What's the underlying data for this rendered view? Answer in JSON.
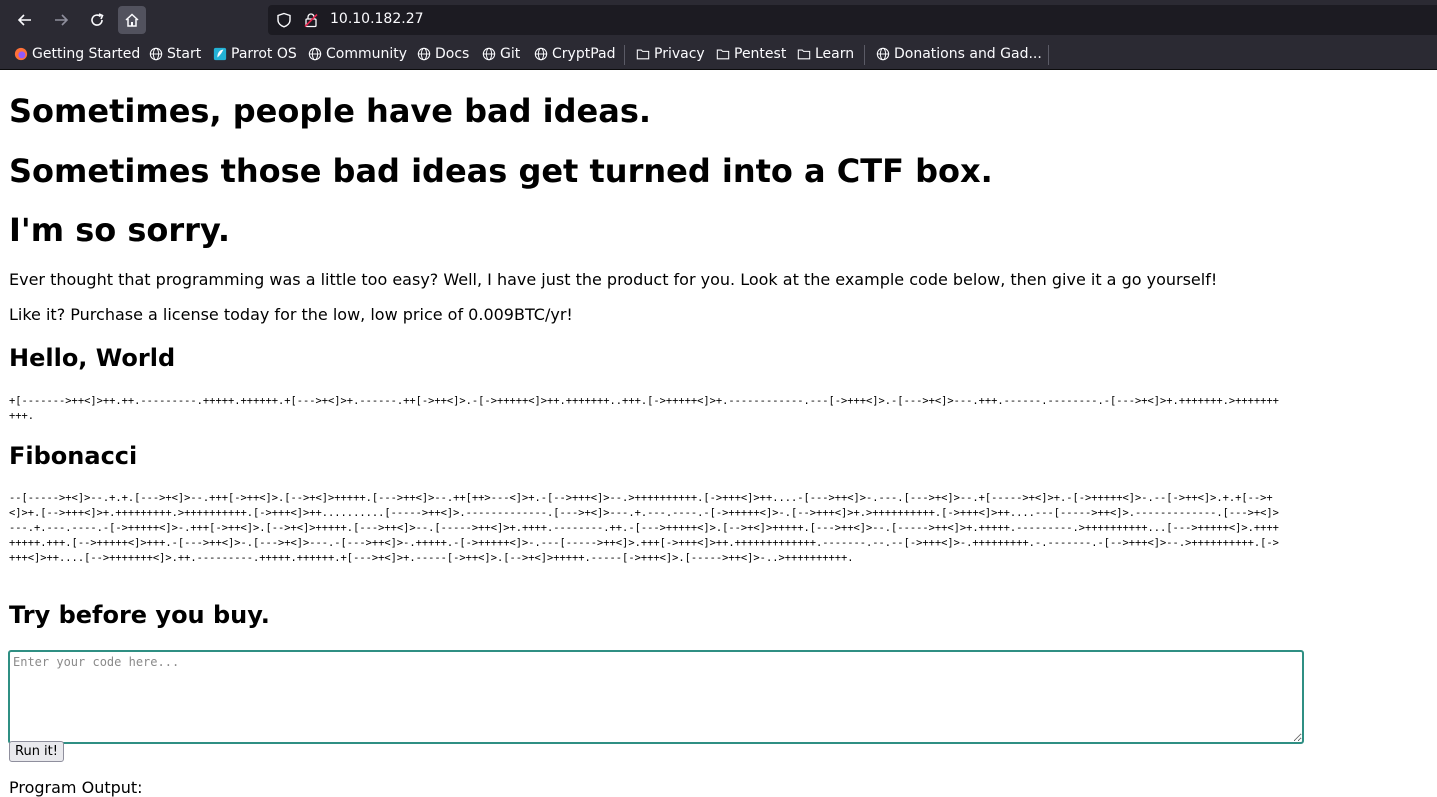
{
  "browser": {
    "url": "10.10.182.27",
    "bookmarks": [
      {
        "label": "Getting Started",
        "icon": "firefox-icon"
      },
      {
        "label": "Start",
        "icon": "globe-icon"
      },
      {
        "label": "Parrot OS",
        "icon": "parrot-icon"
      },
      {
        "label": "Community",
        "icon": "globe-icon"
      },
      {
        "label": "Docs",
        "icon": "globe-icon"
      },
      {
        "label": "Git",
        "icon": "globe-icon"
      },
      {
        "label": "CryptPad",
        "icon": "globe-icon"
      },
      {
        "label": "Privacy",
        "icon": "folder-icon"
      },
      {
        "label": "Pentest",
        "icon": "folder-icon"
      },
      {
        "label": "Learn",
        "icon": "folder-icon"
      },
      {
        "label": "Donations and Gad...",
        "icon": "globe-icon"
      }
    ],
    "colors": {
      "chrome": "#2b2a33",
      "urlbar": "#1c1b22",
      "text": "#fbfbfe",
      "focus": "#2f8f83"
    }
  },
  "page": {
    "heading1": "Sometimes, people have bad ideas.",
    "heading2": "Sometimes those bad ideas get turned into a CTF box.",
    "heading3": "I'm so sorry.",
    "intro": "Ever thought that programming was a little too easy? Well, I have just the product for you. Look at the example code below, then give it a go yourself!",
    "license": "Like it? Purchase a license today for the low, low price of 0.009BTC/yr!",
    "hello_title": "Hello, World",
    "hello_code": "+[------->++<]>++.++.---------.+++++.++++++.+[--->+<]>+.------.++[->++<]>.-[->+++++<]>++.+++++++..+++.[->+++++<]>+.------------.---[->+++<]>.-[--->+<]>---.+++.------.--------.-[--->+<]>+.+++++++.>++++++++++.",
    "fib_title": "Fibonacci",
    "fib_code": "--[----->+<]>--.+.+.[--->+<]>--.+++[->++<]>.[-->+<]>+++++.[--->++<]>--.++[++>---<]>+.-[-->+++<]>--.>++++++++++.[->+++<]>++....-[--->++<]>-.---.[--->+<]>--.+[----->+<]>+.-[->+++++<]>-.--[->++<]>.+.+[-->+<]>+.[-->+++<]>+.+++++++++.>++++++++++.[->+++<]>++..........[----->++<]>.-------------.[--->+<]>---.+.---.----.-[->+++++<]>-.[-->+++<]>+.>++++++++++.[->+++<]>++....---[----->++<]>.-------------.[--->+<]>---.+.---.----.-[->+++++<]>-.+++[->++<]>.[-->+<]>+++++.[--->++<]>--.[----->++<]>+.++++.--------.++.-[--->+++++<]>.[-->+<]>+++++.[--->++<]>--.[----->++<]>+.+++++.---------.>++++++++++...[--->+++++<]>.+++++++++.+++.[-->+++++<]>+++.-[--->++<]>-.[--->+<]>---.-[--->++<]>-.+++++.-[->+++++<]>-.---[----->++<]>.+++[->+++<]>++.+++++++++++++.-------.--.--[->+++<]>-.+++++++++.-.-------.-[-->+++<]>--.>++++++++++.[->+++<]>++....[-->+++++++<]>.++.---------.+++++.++++++.+[--->+<]>+.-----[->++<]>.[-->+<]>+++++.-----[->+++<]>.[----->++<]>-..>++++++++++.",
    "try_title": "Try before you buy.",
    "editor_placeholder": "Enter your code here...",
    "run_label": "Run it!",
    "output_label": "Program Output:"
  }
}
